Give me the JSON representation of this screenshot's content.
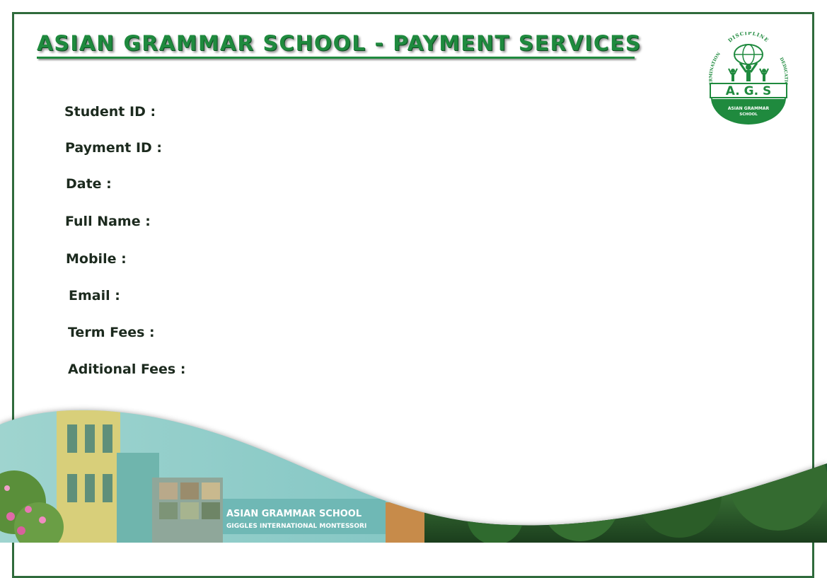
{
  "header": {
    "title": "ASIAN GRAMMAR SCHOOL - PAYMENT SERVICES"
  },
  "logo": {
    "top_text": "DISCIPLINE",
    "left_text": "DETERMINATION",
    "right_text": "DEDICATION",
    "initials": "A. G. S",
    "bottom_text": "ASIAN GRAMMAR",
    "bottom_text_2": "SCHOOL",
    "icon": "globe-with-figures-icon"
  },
  "fields": {
    "student_id": "Student ID :",
    "payment_id": "Payment ID :",
    "date": "Date :",
    "full_name": "Full Name :",
    "mobile": "Mobile :",
    "email": "Email :",
    "term_fees": "Term Fees :",
    "aditional_fees": "Aditional Fees :"
  },
  "photo": {
    "sign_line_1": "ASIAN GRAMMAR SCHOOL",
    "sign_line_2": "GIGGLES INTERNATIONAL MONTESSORI"
  },
  "colors": {
    "brand_green": "#1f8a3e",
    "border_green": "#2f6b3c",
    "label_text": "#1c2a1e"
  }
}
